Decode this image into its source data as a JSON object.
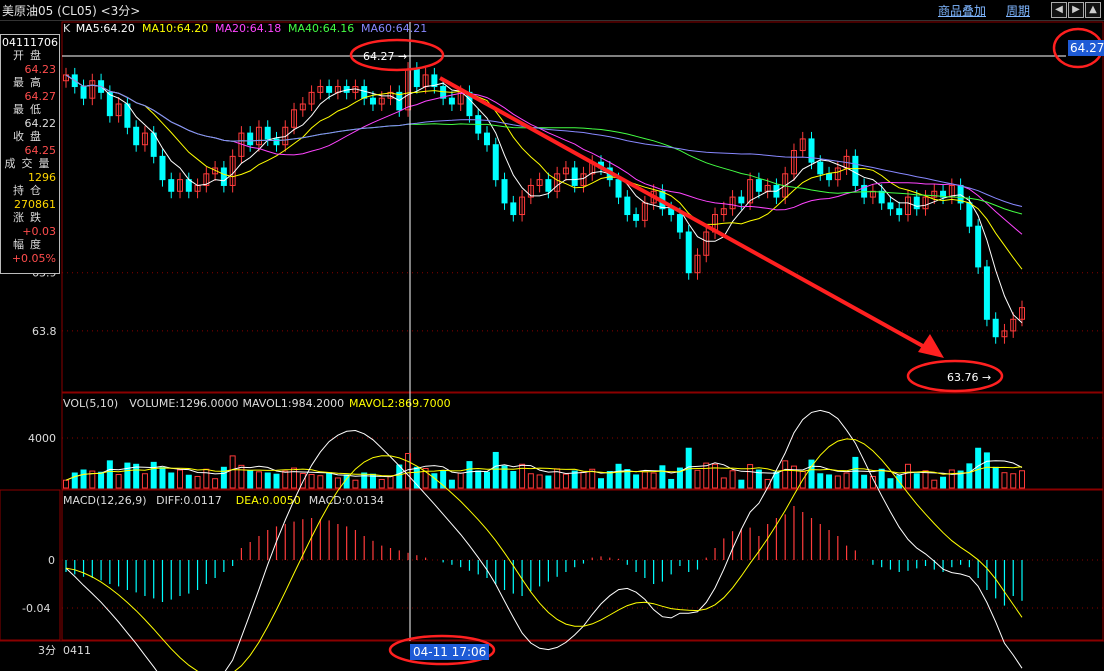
{
  "window": {
    "title": "美原油05 (CL05) <3分>",
    "overlay_button": "商品叠加",
    "period_button": "周期",
    "nav_icons": [
      "left-icon",
      "right-icon",
      "up-icon",
      "down-icon"
    ]
  },
  "side_panel": {
    "code": "04111706",
    "rows": [
      {
        "label": "开盘",
        "value": "64.23",
        "color": "#ff4d4d"
      },
      {
        "label": "最高",
        "value": "64.27",
        "color": "#ff4d4d"
      },
      {
        "label": "最低",
        "value": "64.22",
        "color": "#dddddd"
      },
      {
        "label": "收盘",
        "value": "64.25",
        "color": "#ff4d4d"
      },
      {
        "label": "成交量",
        "value": "1296",
        "color": "#ffd700"
      },
      {
        "label": "持仓",
        "value": "270861",
        "color": "#ffd700"
      },
      {
        "label": "涨跌",
        "value": "+0.03",
        "color": "#ff4d4d"
      },
      {
        "label": "幅度",
        "value": "+0.05%",
        "color": "#ff4d4d"
      }
    ]
  },
  "price_panel": {
    "legend": [
      {
        "text": "K",
        "color": "#dddddd"
      },
      {
        "text": "MA5:64.20",
        "color": "#ffffff"
      },
      {
        "text": "MA10:64.20",
        "color": "#ffff00"
      },
      {
        "text": "MA20:64.18",
        "color": "#ff44ff"
      },
      {
        "text": "MA40:64.16",
        "color": "#44ff44"
      },
      {
        "text": "MA60:64.21",
        "color": "#8888ff"
      }
    ],
    "y_ticks": [
      "63.9",
      "63.8"
    ],
    "ylim": [
      63.75,
      64.3
    ],
    "high_label": "64.27",
    "low_label": "63.76",
    "current_price": "64.27",
    "marker_arrow": "→"
  },
  "volume_panel": {
    "legend": [
      {
        "text": "VOL(5,10)",
        "color": "#dddddd"
      },
      {
        "text": "VOLUME:1296.0000",
        "color": "#dddddd"
      },
      {
        "text": "MAVOL1:984.2000",
        "color": "#dddddd"
      },
      {
        "text": "MAVOL2:869.7000",
        "color": "#ffff00"
      }
    ],
    "y_ticks": [
      "4000"
    ]
  },
  "macd_panel": {
    "legend": [
      {
        "text": "MACD(12,26,9)",
        "color": "#dddddd"
      },
      {
        "text": "DIFF:0.0117",
        "color": "#dddddd"
      },
      {
        "text": "DEA:0.0050",
        "color": "#ffff00"
      },
      {
        "text": "MACD:0.0134",
        "color": "#dddddd"
      }
    ],
    "y_ticks": [
      "0",
      "-0.04"
    ]
  },
  "bottom_axis": {
    "period": "3分",
    "start_date": "0411",
    "cursor_datetime": "04-11 17:06"
  },
  "colors": {
    "up": "#ff3b3b",
    "down": "#00ffff",
    "ma5": "#ffffff",
    "ma10": "#ffff00",
    "ma20": "#ff44ff",
    "ma40": "#44ff44",
    "ma60": "#8888ff",
    "annotation": "#ff2020"
  },
  "chart_data": {
    "type": "candlestick",
    "closes": [
      64.24,
      64.22,
      64.2,
      64.23,
      64.21,
      64.17,
      64.19,
      64.15,
      64.12,
      64.14,
      64.1,
      64.06,
      64.04,
      64.06,
      64.04,
      64.05,
      64.07,
      64.08,
      64.05,
      64.1,
      64.14,
      64.12,
      64.15,
      64.13,
      64.12,
      64.15,
      64.18,
      64.19,
      64.21,
      64.22,
      64.21,
      64.22,
      64.21,
      64.22,
      64.2,
      64.19,
      64.2,
      64.21,
      64.18,
      64.25,
      64.22,
      64.24,
      64.22,
      64.2,
      64.19,
      64.21,
      64.17,
      64.14,
      64.12,
      64.06,
      64.02,
      64.0,
      64.03,
      64.05,
      64.06,
      64.04,
      64.07,
      64.08,
      64.05,
      64.07,
      64.09,
      64.08,
      64.06,
      64.03,
      64.0,
      63.99,
      64.02,
      64.04,
      64.01,
      64.0,
      63.97,
      63.9,
      63.93,
      63.97,
      64.0,
      64.01,
      64.03,
      64.02,
      64.06,
      64.04,
      64.05,
      64.03,
      64.07,
      64.11,
      64.13,
      64.09,
      64.07,
      64.06,
      64.08,
      64.1,
      64.05,
      64.03,
      64.04,
      64.02,
      64.01,
      64.0,
      64.03,
      64.01,
      64.03,
      64.04,
      64.03,
      64.05,
      64.02,
      63.98,
      63.91,
      63.82,
      63.79,
      63.8,
      63.82,
      63.84
    ],
    "macd_bars": [
      -0.01,
      -0.012,
      -0.014,
      -0.015,
      -0.017,
      -0.02,
      -0.022,
      -0.025,
      -0.027,
      -0.03,
      -0.032,
      -0.035,
      -0.033,
      -0.03,
      -0.028,
      -0.025,
      -0.02,
      -0.015,
      -0.01,
      -0.005,
      0.01,
      0.015,
      0.02,
      0.025,
      0.028,
      0.03,
      0.032,
      0.034,
      0.035,
      0.034,
      0.033,
      0.03,
      0.028,
      0.025,
      0.02,
      0.016,
      0.012,
      0.01,
      0.008,
      0.006,
      0.004,
      0.002,
      0.0,
      -0.002,
      -0.004,
      -0.006,
      -0.009,
      -0.012,
      -0.015,
      -0.02,
      -0.025,
      -0.028,
      -0.03,
      -0.026,
      -0.022,
      -0.018,
      -0.014,
      -0.01,
      -0.006,
      -0.003,
      0.002,
      0.003,
      0.002,
      0.001,
      -0.004,
      -0.01,
      -0.015,
      -0.02,
      -0.018,
      -0.012,
      -0.005,
      -0.01,
      -0.008,
      0.002,
      0.01,
      0.018,
      0.024,
      0.026,
      0.027,
      0.02,
      0.03,
      0.035,
      0.038,
      0.045,
      0.04,
      0.035,
      0.03,
      0.025,
      0.02,
      0.012,
      0.008,
      0.0,
      -0.004,
      -0.006,
      -0.008,
      -0.01,
      -0.009,
      -0.007,
      -0.005,
      -0.008,
      -0.01,
      -0.006,
      -0.004,
      -0.006,
      -0.015,
      -0.025,
      -0.032,
      -0.038,
      -0.03,
      -0.034
    ]
  }
}
